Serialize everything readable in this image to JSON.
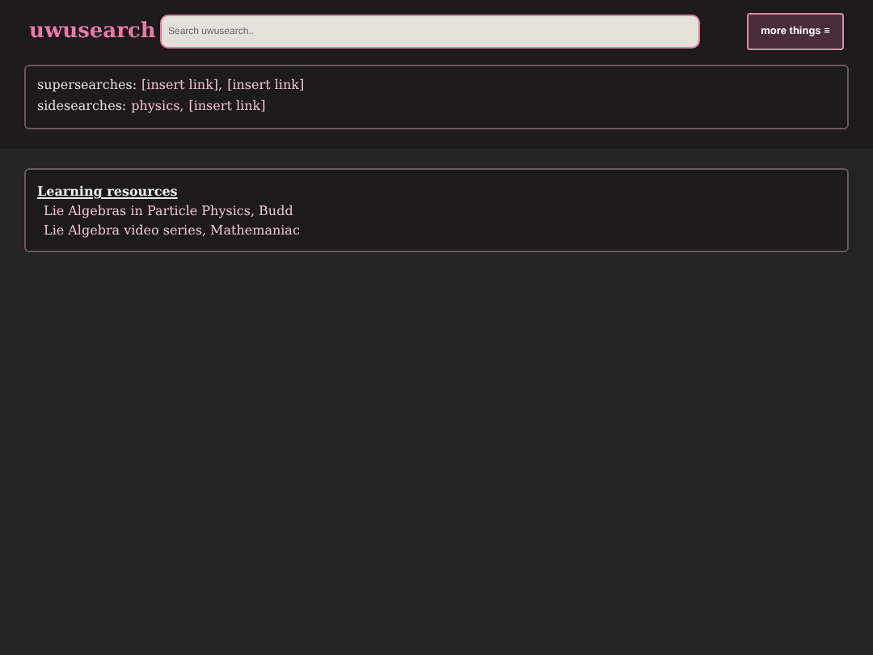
{
  "header": {
    "logo": "uwusearch",
    "search": {
      "placeholder": "Search uwusearch.."
    },
    "menu_button": "more things ≡"
  },
  "related": [
    {
      "label": "supersearches:",
      "links": [
        "[insert link],",
        "[insert link]"
      ]
    },
    {
      "label": "sidesearches:",
      "links": [
        "physics,",
        "[insert link]"
      ]
    }
  ],
  "resources": {
    "title": "Learning resources",
    "items": [
      "Lie Algebras in Particle Physics, Budd",
      "Lie Algebra video series, Mathemaniac"
    ]
  }
}
